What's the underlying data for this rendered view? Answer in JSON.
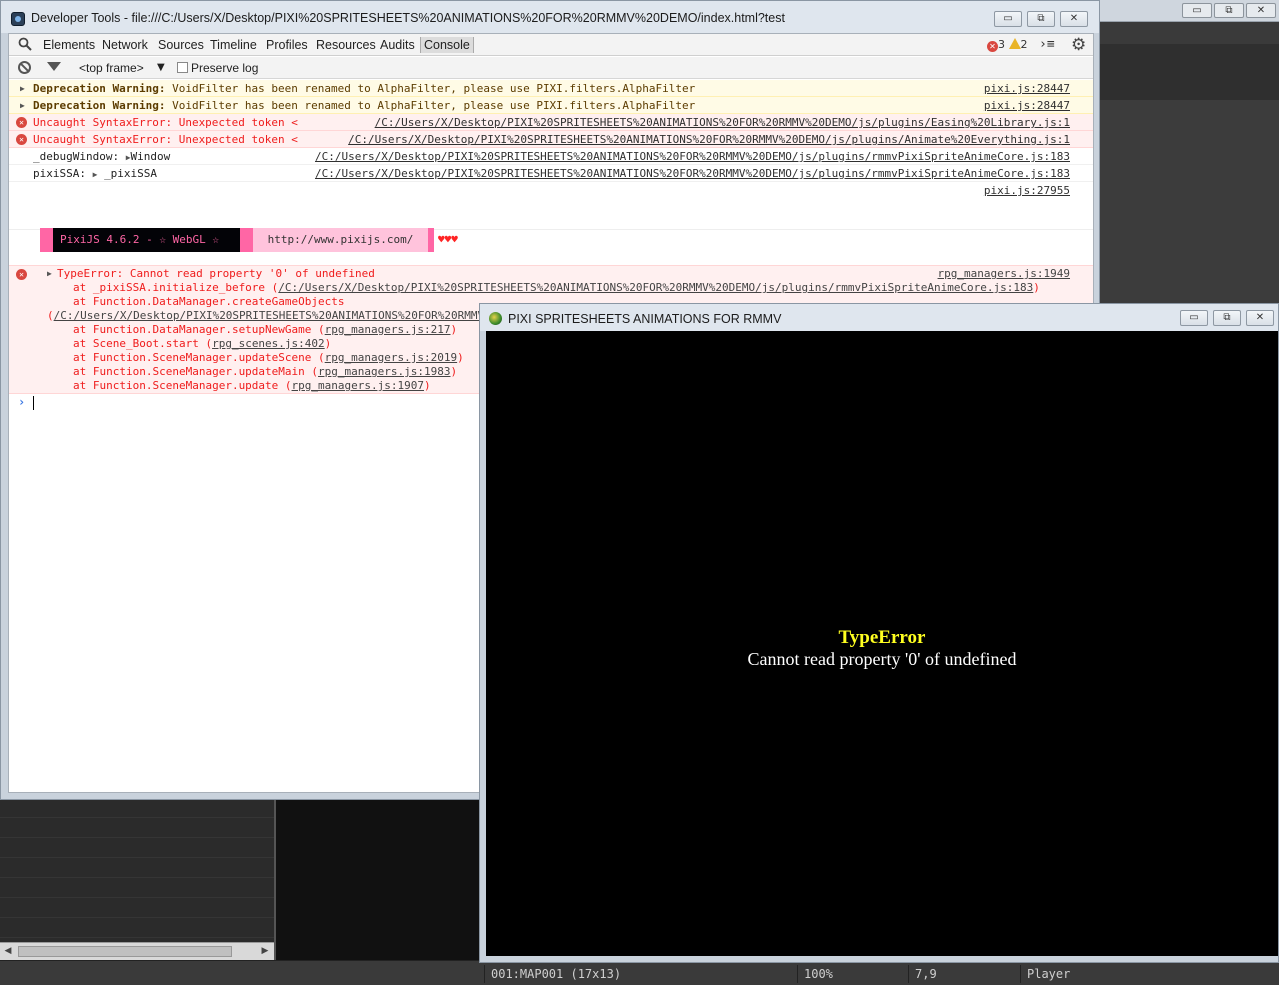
{
  "devtools": {
    "title": "Developer Tools - file:///C:/Users/X/Desktop/PIXI%20SPRITESHEETS%20ANIMATIONS%20FOR%20RMMV%20DEMO/index.html?test",
    "tabs": [
      "Elements",
      "Network",
      "Sources",
      "Timeline",
      "Profiles",
      "Resources",
      "Audits",
      "Console"
    ],
    "active_tab": "Console",
    "error_count": "3",
    "warning_count": "2",
    "frame_select": "<top frame>",
    "preserve_log_label": "Preserve log"
  },
  "console": {
    "messages": [
      {
        "label": "Deprecation Warning:",
        "text": " VoidFilter has been renamed to AlphaFilter, please use PIXI.filters.AlphaFilter",
        "source": "pixi.js:28447"
      },
      {
        "label": "Deprecation Warning:",
        "text": " VoidFilter has been renamed to AlphaFilter, please use PIXI.filters.AlphaFilter",
        "source": "pixi.js:28447"
      },
      {
        "text": "Uncaught SyntaxError: Unexpected token <",
        "source": "/C:/Users/X/Desktop/PIXI%20SPRITESHEETS%20ANIMATIONS%20FOR%20RMMV%20DEMO/js/plugins/Easing%20Library.js:1"
      },
      {
        "text": "Uncaught SyntaxError: Unexpected token <",
        "source": "/C:/Users/X/Desktop/PIXI%20SPRITESHEETS%20ANIMATIONS%20FOR%20RMMV%20DEMO/js/plugins/Animate%20Everything.js:1"
      },
      {
        "key": "_debugWindow:",
        "value": "Window",
        "source": "/C:/Users/X/Desktop/PIXI%20SPRITESHEETS%20ANIMATIONS%20FOR%20RMMV%20DEMO/js/plugins/rmmvPixiSpriteAnimeCore.js:183"
      },
      {
        "key": "pixiSSA:",
        "value": "_pixiSSA",
        "source": "/C:/Users/X/Desktop/PIXI%20SPRITESHEETS%20ANIMATIONS%20FOR%20RMMV%20DEMO/js/plugins/rmmvPixiSpriteAnimeCore.js:183"
      }
    ],
    "pixi_banner": {
      "source": "pixi.js:27955",
      "version": "PixiJS 4.6.2 - ☆ WebGL ☆",
      "url": "http://www.pixijs.com/",
      "hearts": "♥♥♥"
    },
    "type_error": {
      "message": "TypeError: Cannot read property '0' of undefined",
      "source": "rpg_managers.js:1949",
      "stack": [
        {
          "prefix": "at _pixiSSA.initialize_before (",
          "link": "/C:/Users/X/Desktop/PIXI%20SPRITESHEETS%20ANIMATIONS%20FOR%20RMMV%20DEMO/js/plugins/rmmvPixiSpriteAnimeCore.js:183",
          "suffix": ")"
        },
        {
          "prefix": "at Function.DataManager.createGameObjects",
          "link": "",
          "suffix": ""
        },
        {
          "prefix": "(",
          "link": "/C:/Users/X/Desktop/PIXI%20SPRITESHEETS%20ANIMATIONS%20FOR%20RMMV%20DEMO/js/plugins/rmmvPixiSpriteAnimeCore.js:183",
          "suffix": ")"
        },
        {
          "prefix": "at Function.DataManager.setupNewGame (",
          "link": "rpg_managers.js:217",
          "suffix": ")"
        },
        {
          "prefix": "at Scene_Boot.start (",
          "link": "rpg_scenes.js:402",
          "suffix": ")"
        },
        {
          "prefix": "at Function.SceneManager.updateScene (",
          "link": "rpg_managers.js:2019",
          "suffix": ")"
        },
        {
          "prefix": "at Function.SceneManager.updateMain (",
          "link": "rpg_managers.js:1983",
          "suffix": ")"
        },
        {
          "prefix": "at Function.SceneManager.update (",
          "link": "rpg_managers.js:1907",
          "suffix": ")"
        }
      ]
    },
    "prompt": "›"
  },
  "game": {
    "title": "PIXI SPRITESHEETS ANIMATIONS FOR RMMV",
    "error_title": "TypeError",
    "error_message": "Cannot read property '0' of undefined"
  },
  "statusbar": {
    "map": "001:MAP001 (17x13)",
    "zoom": "100%",
    "coords": "7,9",
    "mode": "Player"
  },
  "window_controls": {
    "minimize": "▭",
    "maximize": "⧉",
    "close": "✕"
  },
  "colors": {
    "error_red": "#ef1c1c",
    "warning_bg": "#fffbe6",
    "pixi_pink": "#ff66a5",
    "game_error_title": "#ffff20"
  }
}
